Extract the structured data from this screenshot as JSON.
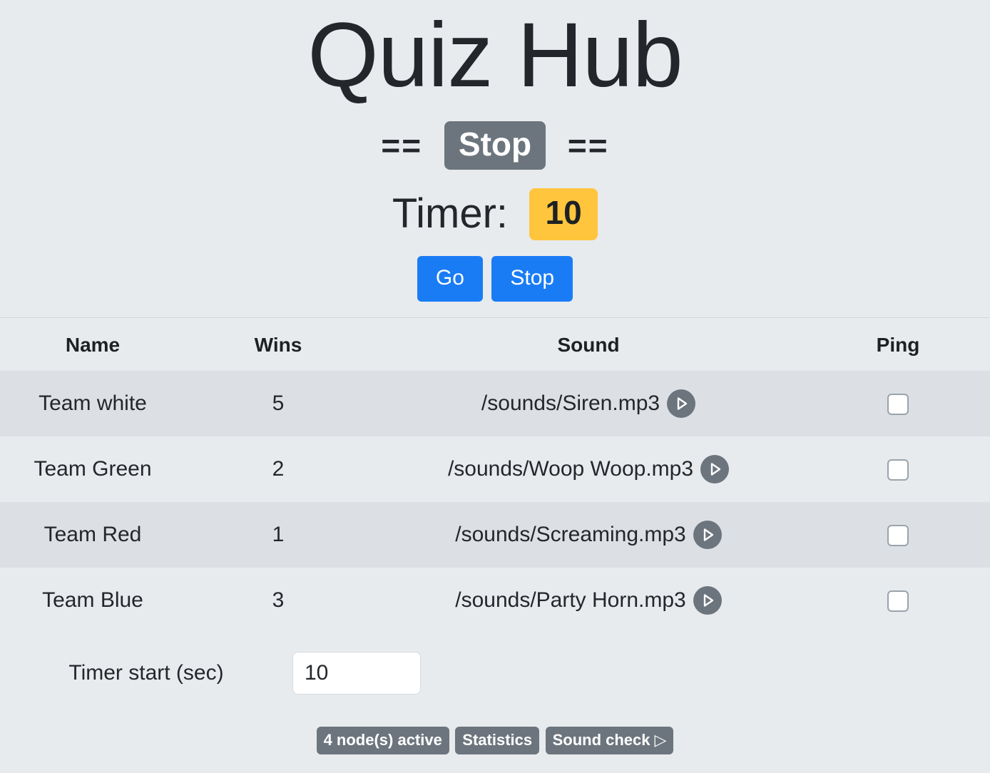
{
  "app": {
    "title": "Quiz Hub"
  },
  "status": {
    "left_rule": "==",
    "right_rule": "==",
    "state_label": "Stop"
  },
  "timer": {
    "label": "Timer:",
    "value": "10"
  },
  "controls": {
    "go_label": "Go",
    "stop_label": "Stop"
  },
  "table": {
    "headers": {
      "name": "Name",
      "wins": "Wins",
      "sound": "Sound",
      "ping": "Ping"
    },
    "rows": [
      {
        "name": "Team white",
        "wins": "5",
        "sound": "/sounds/Siren.mp3",
        "play_icon": "play-icon",
        "ping_checked": false
      },
      {
        "name": "Team Green",
        "wins": "2",
        "sound": "/sounds/Woop Woop.mp3",
        "play_icon": "play-icon",
        "ping_checked": false
      },
      {
        "name": "Team Red",
        "wins": "1",
        "sound": "/sounds/Screaming.mp3",
        "play_icon": "play-icon",
        "ping_checked": false
      },
      {
        "name": "Team Blue",
        "wins": "3",
        "sound": "/sounds/Party Horn.mp3",
        "play_icon": "play-icon",
        "ping_checked": false
      }
    ]
  },
  "settings": {
    "timer_start_label": "Timer start (sec)",
    "timer_start_value": "10",
    "timer_start_placeholder": ""
  },
  "footer": {
    "nodes_label": "4 node(s) active",
    "statistics_label": "Statistics",
    "sound_check_label": "Sound check",
    "sound_check_glyph": "▷"
  },
  "colors": {
    "background": "#e8ebee",
    "row_stripe": "#dce0e4",
    "accent_blue": "#1a7cf5",
    "badge_gray": "#6c757d",
    "timer_amber": "#ffc53d",
    "text": "#23272b"
  }
}
